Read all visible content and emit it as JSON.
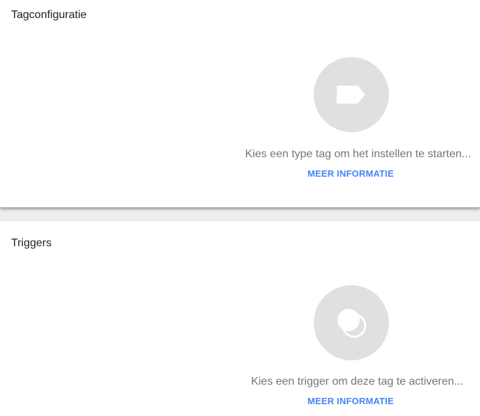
{
  "tag_config": {
    "title": "Tagconfiguratie",
    "icon": "tag-icon",
    "prompt": "Kies een type tag om het instellen te starten...",
    "more_info": "MEER INFORMATIE"
  },
  "triggers": {
    "title": "Triggers",
    "icon": "trigger-circles-icon",
    "prompt": "Kies een trigger om deze tag te activeren...",
    "more_info": "MEER INFORMATIE"
  },
  "colors": {
    "accent_link": "#4285f4",
    "icon_circle": "#e0e0e0",
    "prompt_text": "#757575"
  }
}
